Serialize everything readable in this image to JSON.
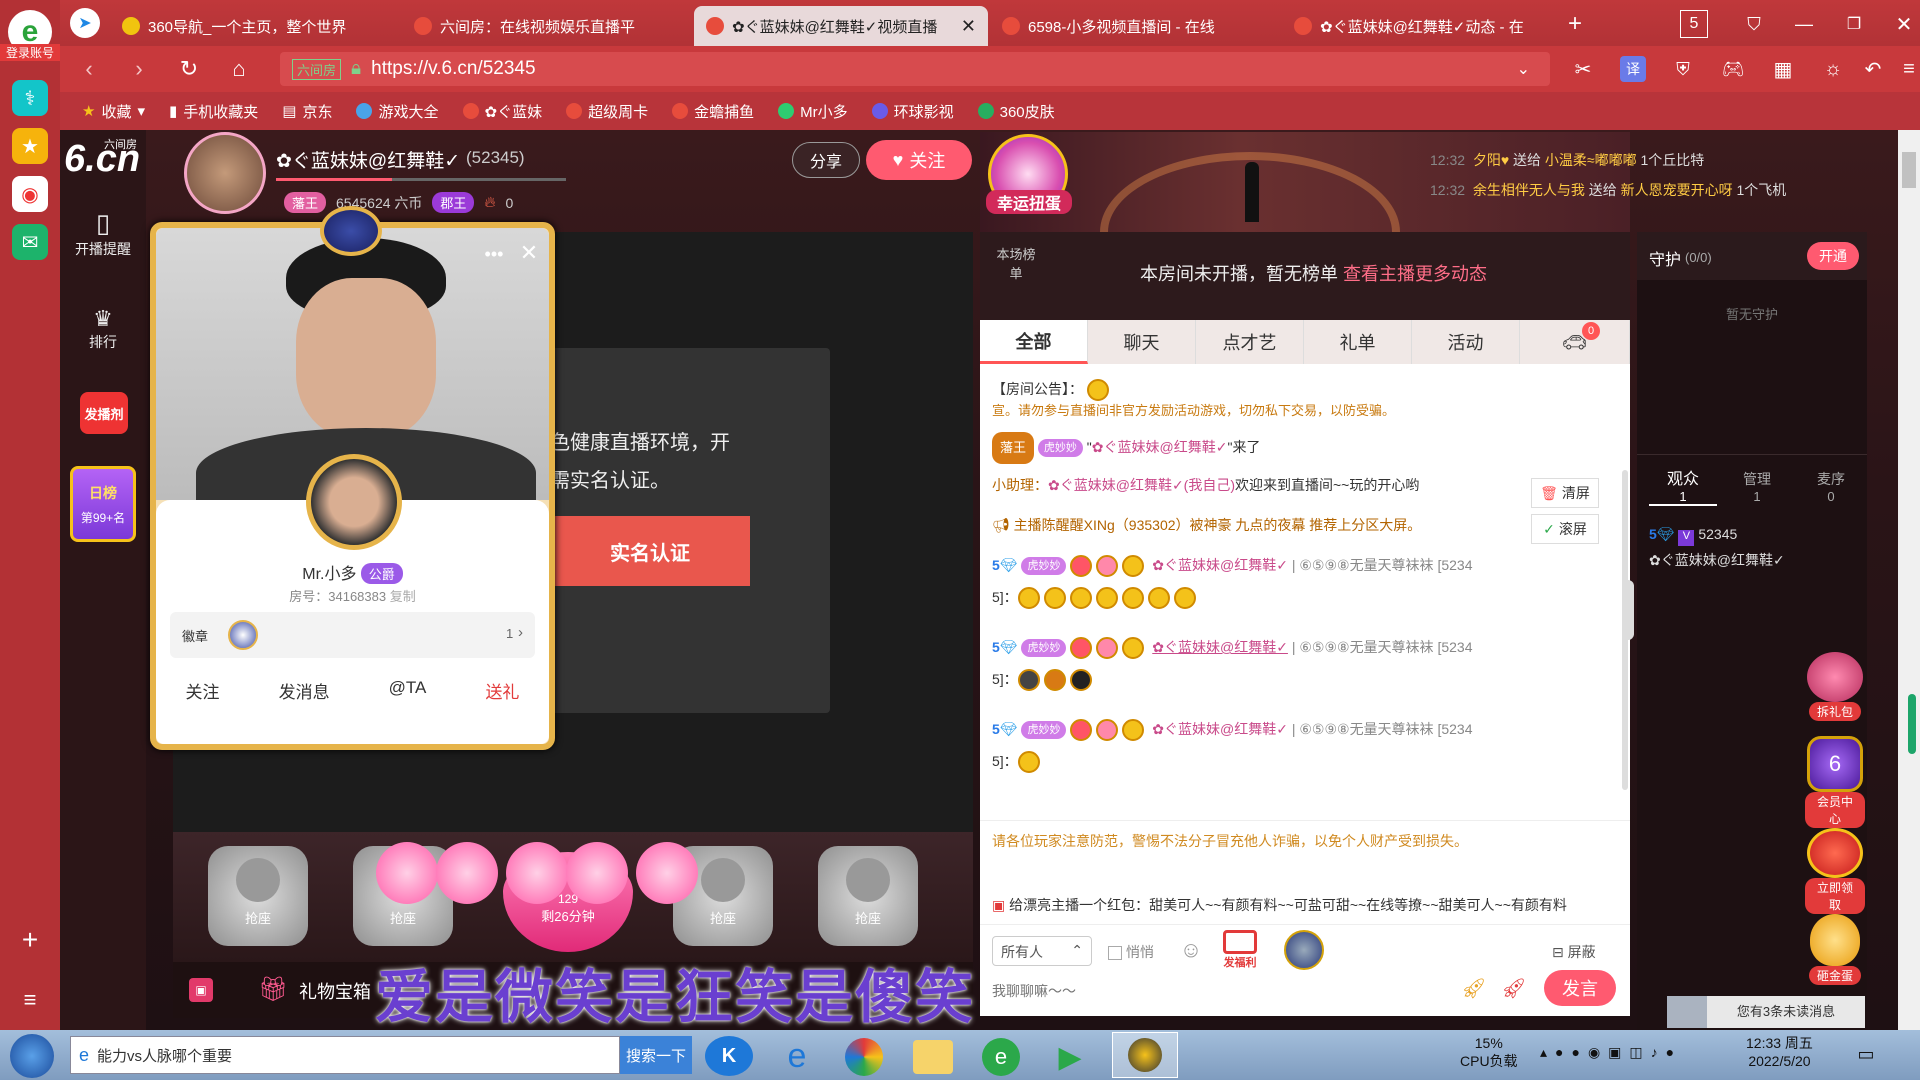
{
  "browser": {
    "login_label": "登录账号",
    "tabs": [
      {
        "title": "360导航_一个主页，整个世界",
        "color": "#f1c40f",
        "active": false
      },
      {
        "title": "六间房：在线视频娱乐直播平",
        "color": "#e74c3c",
        "active": false
      },
      {
        "title": "✿ぐ蓝妹妹@红舞鞋✓视频直播",
        "color": "#e74c3c",
        "active": true
      },
      {
        "title": "6598-小多视频直播间 - 在线",
        "color": "#e74c3c",
        "active": false
      },
      {
        "title": "✿ぐ蓝妹妹@红舞鞋✓动态 - 在",
        "color": "#e74c3c",
        "active": false
      }
    ],
    "url": "https://v.6.cn/52345",
    "site_label": "六间房",
    "bookmarks": [
      "收藏",
      "手机收藏夹",
      "京东",
      "游戏大全",
      "✿ぐ蓝妹",
      "超级周卡",
      "金蟾捕鱼",
      "Mr小多",
      "环球影视",
      "360皮肤"
    ]
  },
  "sidenav": {
    "logo": "6.cn",
    "logo_sub": "六间房",
    "remind": "开播提醒",
    "rank": "排行",
    "day_rank": "日榜",
    "day_rank_value": "第99+名",
    "broadcast_award": "发播剂"
  },
  "host": {
    "name": "✿ぐ蓝妹妹@红舞鞋✓",
    "room_id": "(52345)",
    "coins": "6545624 六币",
    "badge1": "藩王",
    "badge2": "郡王",
    "heat": "0",
    "share": "分享",
    "follow": "关注"
  },
  "banner": {
    "lucky": "幸运扭蛋"
  },
  "gift_feed": [
    {
      "time": "12:32",
      "from": "夕阳♥",
      "verb": "送给",
      "to": "小温柔≈嘟嘟嘟",
      "item": "1个丘比特"
    },
    {
      "time": "12:32",
      "from": "余生相伴无人与我",
      "verb": "送给",
      "to": "新人恩宠要开心呀",
      "item": "1个飞机"
    }
  ],
  "verify": {
    "line1": "色健康直播环境，开",
    "line2": "需实名认证。",
    "button": "实名认证"
  },
  "card": {
    "name": "Mr.小多",
    "tag": "公爵",
    "room_label": "房号：34168383",
    "copy": "复制",
    "badge_label": "徽章",
    "badge_count": "1",
    "actions": [
      "关注",
      "发消息",
      "@TA",
      "送礼"
    ]
  },
  "seats": {
    "label": "抢座",
    "timer": "剩26分钟",
    "timer_num": "129"
  },
  "bottom": {
    "gift_box": "礼物宝箱"
  },
  "marquee": "爱是微笑是狂笑是傻笑",
  "rank": {
    "label": "本场榜单",
    "text": "本房间未开播，暂无榜单",
    "link": "查看主播更多动态"
  },
  "chat": {
    "tabs": [
      "全部",
      "聊天",
      "点才艺",
      "礼单",
      "活动"
    ],
    "car_count": "0",
    "announcement": "【房间公告】：",
    "clipped": "宣。请勿参与直播间非官方发励活动游戏，切勿私下交易，以防受骗。",
    "enter": {
      "badge": "藩王",
      "level": "虎妙妙",
      "nick": "✿ぐ蓝妹妹@红舞鞋✓",
      "suffix": "来了"
    },
    "assistant": {
      "label": "小助理：",
      "nick": "✿ぐ蓝妹妹@红舞鞋✓(我自己)",
      "text": "欢迎来到直播间~~玩的开心哟"
    },
    "recommend": "主播陈醒醒XINg（935302）被神豪 九点的夜幕 推荐上分区大屏。",
    "clear": "清屏",
    "scroll": "滚屏",
    "messages": [
      {
        "prefix": "5",
        "nick": "✿ぐ蓝妹妹@红舞鞋✓",
        "target": "⑥⑤⑨⑧无量天尊袜袜",
        "room": "[5234",
        "room2": "5]："
      },
      {
        "prefix": "5",
        "nick": "✿ぐ蓝妹妹@红舞鞋✓",
        "target": "⑥⑤⑨⑧无量天尊袜袜",
        "room": "[5234",
        "room2": "5]："
      },
      {
        "prefix": "5",
        "nick": "✿ぐ蓝妹妹@红舞鞋✓",
        "target": "⑥⑤⑨⑧无量天尊袜袜",
        "room": "[5234",
        "room2": "5]："
      }
    ],
    "warning": "请各位玩家注意防范，警惕不法分子冒充他人诈骗，以免个人财产受到损失。",
    "redpacket": "给漂亮主播一个红包：甜美可人~~有颜有料~~可盐可甜~~在线等撩~~甜美可人~~有颜有料",
    "recipient": "所有人",
    "whisper": "悄悄",
    "block": "屏蔽",
    "fafuli": "发福利",
    "placeholder": "我聊聊嘛～～",
    "send": "发言"
  },
  "right": {
    "guard": "守护",
    "guard_count": "(0/0)",
    "open": "开通",
    "no_guard": "暂无守护",
    "tabs": [
      {
        "label": "观众",
        "count": "1"
      },
      {
        "label": "管理",
        "count": "1"
      },
      {
        "label": "麦序",
        "count": "0"
      }
    ],
    "viewer_id": "52345",
    "viewer_nick": "✿ぐ蓝妹妹@红舞鞋✓",
    "gift_pack": "拆礼包",
    "member": "会员中心",
    "get_now": "立即领取",
    "gold_egg": "砸金蛋",
    "unread": "您有3条未读消息"
  },
  "taskbar": {
    "search_text": "能力vs人脉哪个重要",
    "search_btn": "搜索一下",
    "cpu": "15%",
    "cpu_label": "CPU负载",
    "time": "12:33 周五",
    "date": "2022/5/20"
  }
}
